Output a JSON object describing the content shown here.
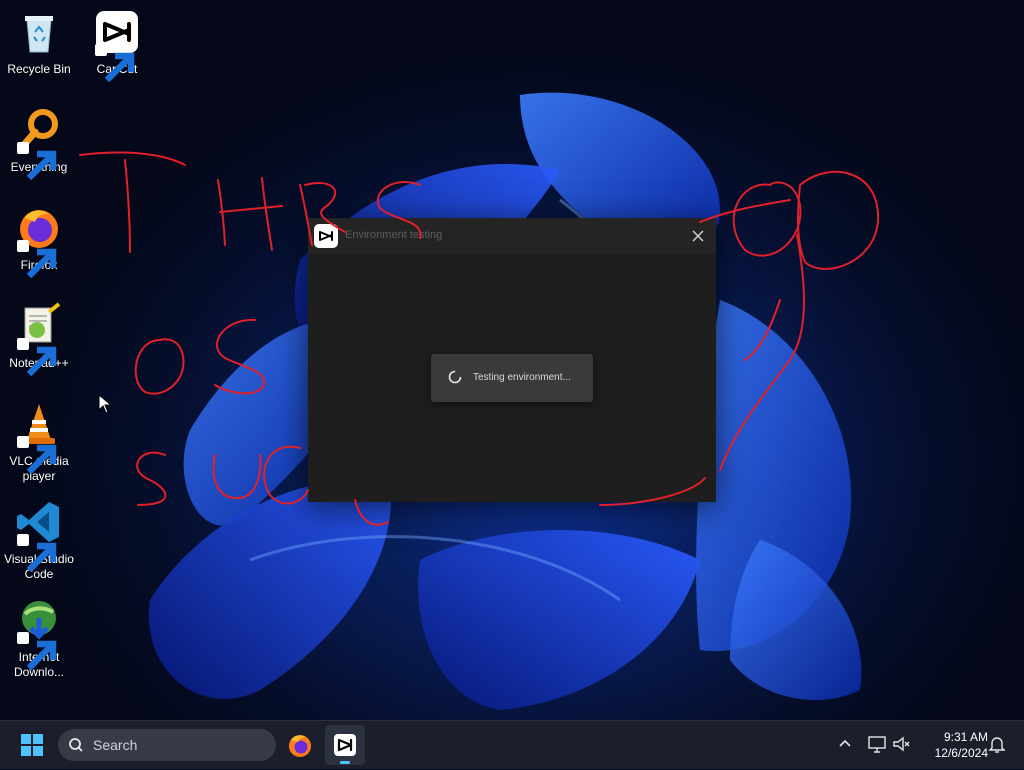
{
  "desktop": {
    "icons": [
      {
        "label": "Recycle Bin"
      },
      {
        "label": "CapCut"
      },
      {
        "label": "Everything"
      },
      {
        "label": "Firefox"
      },
      {
        "label": "Notepad++"
      },
      {
        "label": "VLC media player"
      },
      {
        "label": "Visual Studio Code"
      },
      {
        "label": "Internet Downlo..."
      }
    ]
  },
  "dialog": {
    "title": "Environment testing",
    "close_glyph": "✕",
    "status_text": "Testing environment..."
  },
  "taskbar": {
    "search_label": "Search",
    "pinned": [
      "firefox-icon",
      "capcut-icon"
    ],
    "clock": {
      "time": "9:31 AM",
      "date": "12/6/2024"
    }
  },
  "colors": {
    "scribble": "#e0202a",
    "taskbar_bg": "#1a1f2b",
    "dialog_bg": "#1e1e1e",
    "toast_bg": "#3a3a3a",
    "accent": "#4cc2ff"
  }
}
